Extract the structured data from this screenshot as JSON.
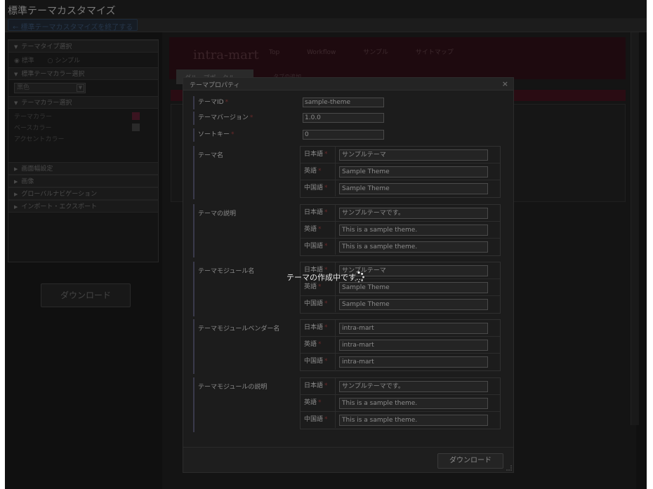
{
  "window": {
    "title": "標準テーマカスタマイズ"
  },
  "topbar": {
    "exit_link": "← 標準テーマカスタマイズを終了する"
  },
  "sidebar": {
    "sections": [
      {
        "label": "テーマタイプ選択"
      },
      {
        "label": "標準テーマカラー選択"
      },
      {
        "label": "テーマカラー選択"
      },
      {
        "label": "画面幅設定"
      },
      {
        "label": "画像"
      },
      {
        "label": "グローバルナビゲーション"
      },
      {
        "label": "インポート・エクスポート"
      }
    ],
    "theme_type": {
      "option_standard": "標準",
      "option_simple": "シンプル"
    },
    "standard_color": {
      "selected": "黒色"
    },
    "colors": [
      {
        "label": "テーマカラー"
      },
      {
        "label": "ベースカラー"
      },
      {
        "label": "アクセントカラー"
      }
    ],
    "download_label": "ダウンロード"
  },
  "portal": {
    "logo": "intra-mart",
    "nav": [
      "Top",
      "Workflow",
      "サンプル",
      "サイトマップ"
    ],
    "tab_active": "グループポータル",
    "tab_other": "タブの追加"
  },
  "dialog": {
    "title": "テーマプロパティ",
    "close": "×",
    "required_mark": "*",
    "fields": [
      {
        "label": "テーマID",
        "value": "sample-theme"
      },
      {
        "label": "テーマバージョン",
        "value": "1.0.0"
      },
      {
        "label": "ソートキー",
        "value": "0"
      }
    ],
    "groups": [
      {
        "label": "テーマ名",
        "langs": [
          {
            "lang": "日本語",
            "value": "サンプルテーマ"
          },
          {
            "lang": "英語",
            "value": "Sample Theme"
          },
          {
            "lang": "中国語",
            "value": "Sample Theme"
          }
        ]
      },
      {
        "label": "テーマの説明",
        "langs": [
          {
            "lang": "日本語",
            "value": "サンプルテーマです。"
          },
          {
            "lang": "英語",
            "value": "This is a sample theme."
          },
          {
            "lang": "中国語",
            "value": "This is a sample theme."
          }
        ]
      },
      {
        "label": "テーマモジュール名",
        "langs": [
          {
            "lang": "日本語",
            "value": "サンプルテーマ"
          },
          {
            "lang": "英語",
            "value": "Sample Theme"
          },
          {
            "lang": "中国語",
            "value": "Sample Theme"
          }
        ]
      },
      {
        "label": "テーマモジュールベンダー名",
        "langs": [
          {
            "lang": "日本語",
            "value": "intra-mart"
          },
          {
            "lang": "英語",
            "value": "intra-mart"
          },
          {
            "lang": "中国語",
            "value": "intra-mart"
          }
        ]
      },
      {
        "label": "テーマモジュールの説明",
        "langs": [
          {
            "lang": "日本語",
            "value": "サンプルテーマです。"
          },
          {
            "lang": "英語",
            "value": "This is a sample theme."
          },
          {
            "lang": "中国語",
            "value": "This is a sample theme."
          }
        ]
      }
    ],
    "download_button": "ダウンロード"
  },
  "loading": {
    "text": "テーマの作成中です..."
  }
}
